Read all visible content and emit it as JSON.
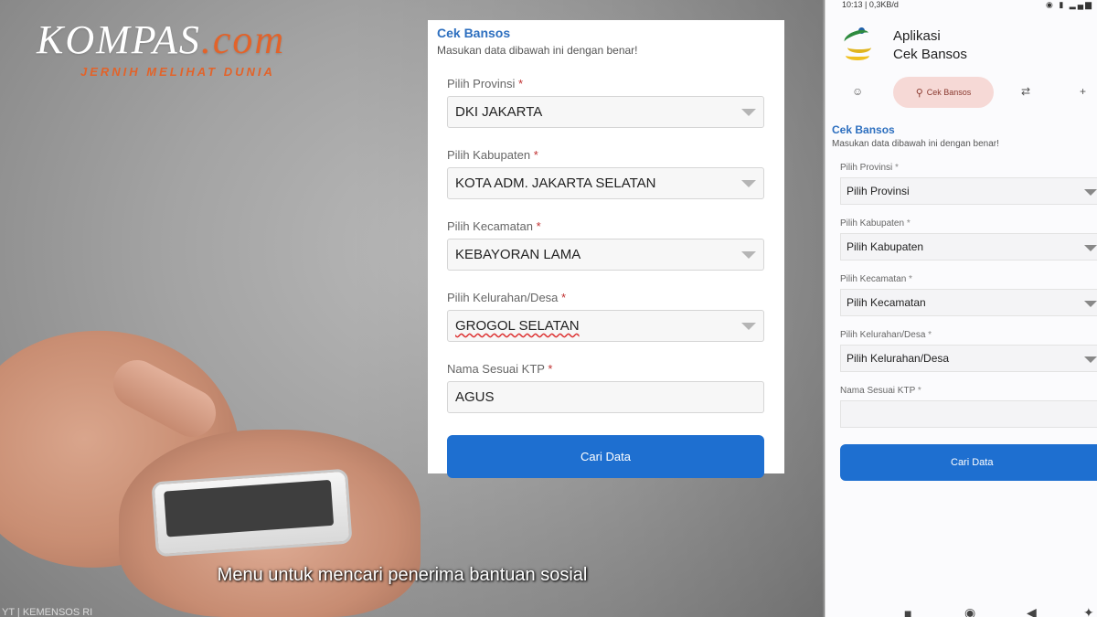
{
  "logo": {
    "brand": "KOMPAS",
    "domain": ".com",
    "tagline": "JERNIH MELIHAT DUNIA"
  },
  "form": {
    "title": "Cek Bansos",
    "subtitle": "Masukan data dibawah ini dengan benar!",
    "fields": [
      {
        "label": "Pilih Provinsi",
        "value": "DKI JAKARTA"
      },
      {
        "label": "Pilih Kabupaten",
        "value": "KOTA ADM. JAKARTA SELATAN"
      },
      {
        "label": "Pilih Kecamatan",
        "value": "KEBAYORAN LAMA"
      },
      {
        "label": "Pilih Kelurahan/Desa",
        "value": "GROGOL SELATAN"
      },
      {
        "label": "Nama Sesuai KTP",
        "value": "AGUS"
      }
    ],
    "required_mark": "*",
    "button": "Cari Data"
  },
  "caption": "Menu untuk mencari penerima bantuan sosial",
  "watermark": "YT | KEMENSOS RI",
  "phone": {
    "status_left": "10:13 | 0,3KB/d",
    "app_name_line1": "Aplikasi",
    "app_name_line2": "Cek Bansos",
    "active_tab": "Cek Bansos",
    "form_title": "Cek Bansos",
    "form_subtitle": "Masukan data dibawah ini dengan benar!",
    "fields": [
      {
        "label": "Pilih Provinsi",
        "value": "Pilih Provinsi"
      },
      {
        "label": "Pilih Kabupaten",
        "value": "Pilih Kabupaten"
      },
      {
        "label": "Pilih Kecamatan",
        "value": "Pilih Kecamatan"
      },
      {
        "label": "Pilih Kelurahan/Desa",
        "value": "Pilih Kelurahan/Desa"
      },
      {
        "label": "Nama Sesuai KTP",
        "value": ""
      }
    ],
    "required_mark": "*",
    "button": "Cari Data"
  },
  "colors": {
    "accent_blue": "#1e6fd0",
    "title_blue": "#2d6fbf",
    "brand_orange": "#e2632a",
    "active_tab_bg": "#f6d9d6"
  },
  "icons": [
    "profile-icon",
    "person-search-icon",
    "swap-icon",
    "add-person-icon",
    "square-nav-icon",
    "circle-nav-icon",
    "back-nav-icon"
  ]
}
